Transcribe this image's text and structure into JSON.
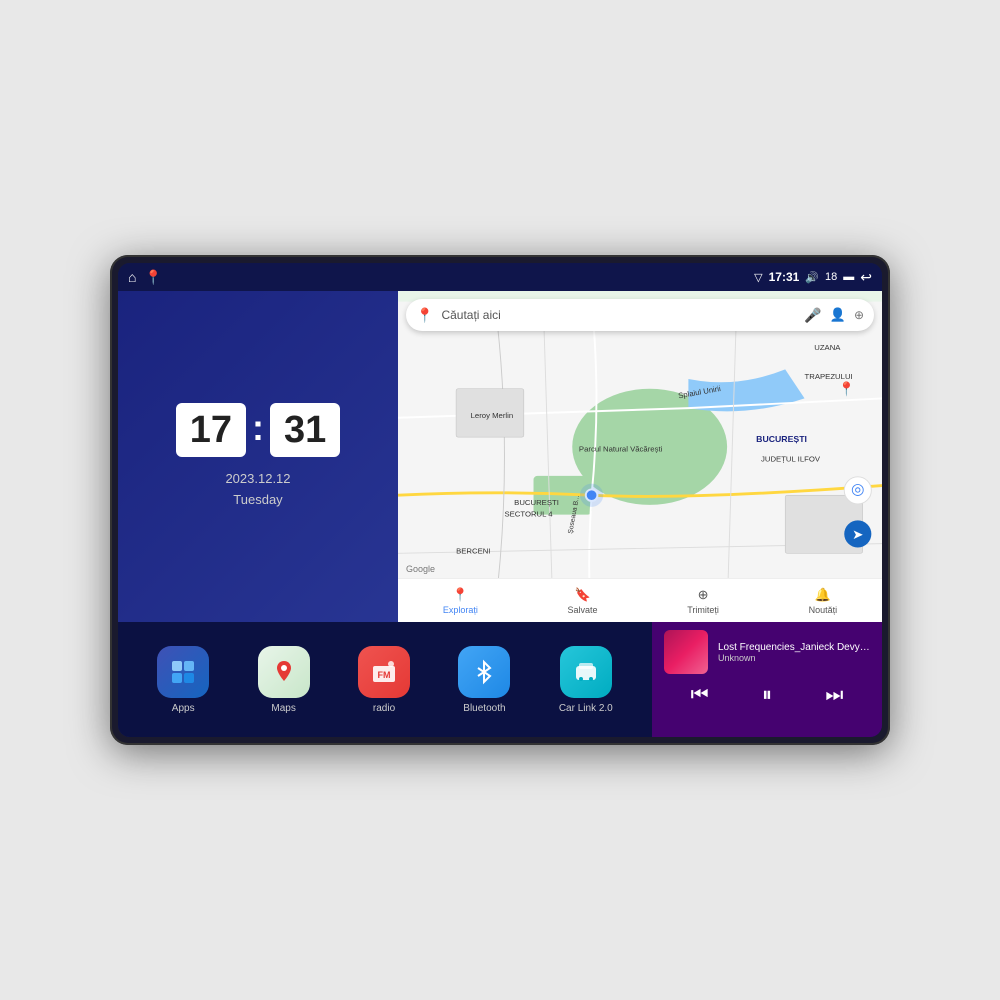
{
  "device": {
    "status_bar": {
      "left_icons": [
        "home",
        "maps-pin"
      ],
      "time": "17:31",
      "signal_icon": "signal",
      "volume_icon": "volume",
      "volume_level": "18",
      "battery_icon": "battery",
      "back_icon": "back"
    }
  },
  "clock": {
    "hours": "17",
    "minutes": "31",
    "date": "2023.12.12",
    "day": "Tuesday"
  },
  "map": {
    "search_placeholder": "Căutați aici",
    "location": "București",
    "nav_items": [
      {
        "label": "Explorați",
        "icon": "📍",
        "active": true
      },
      {
        "label": "Salvate",
        "icon": "🔖",
        "active": false
      },
      {
        "label": "Trimiteți",
        "icon": "⊕",
        "active": false
      },
      {
        "label": "Noutăți",
        "icon": "🔔",
        "active": false
      }
    ],
    "places": [
      "Parcul Natural Văcărești",
      "Leroy Merlin",
      "BUCUREȘTI SECTORUL 4",
      "BUCUREȘTI",
      "JUDEȚUL ILFOV",
      "BERCENI",
      "TRAPEZULUI",
      "UZANA"
    ],
    "streets": [
      "Splaiul Unirii",
      "Șoseaua B..."
    ]
  },
  "apps": [
    {
      "id": "apps",
      "label": "Apps",
      "icon": "⊞",
      "color_class": "icon-apps"
    },
    {
      "id": "maps",
      "label": "Maps",
      "icon": "🗺",
      "color_class": "icon-maps"
    },
    {
      "id": "radio",
      "label": "radio",
      "icon": "📻",
      "color_class": "icon-radio"
    },
    {
      "id": "bluetooth",
      "label": "Bluetooth",
      "icon": "🔵",
      "color_class": "icon-bluetooth"
    },
    {
      "id": "carlink",
      "label": "Car Link 2.0",
      "icon": "🚗",
      "color_class": "icon-carlink"
    }
  ],
  "music": {
    "title": "Lost Frequencies_Janieck Devy-...",
    "artist": "Unknown",
    "controls": {
      "prev": "⏮",
      "play_pause": "⏸",
      "next": "⏭"
    }
  }
}
